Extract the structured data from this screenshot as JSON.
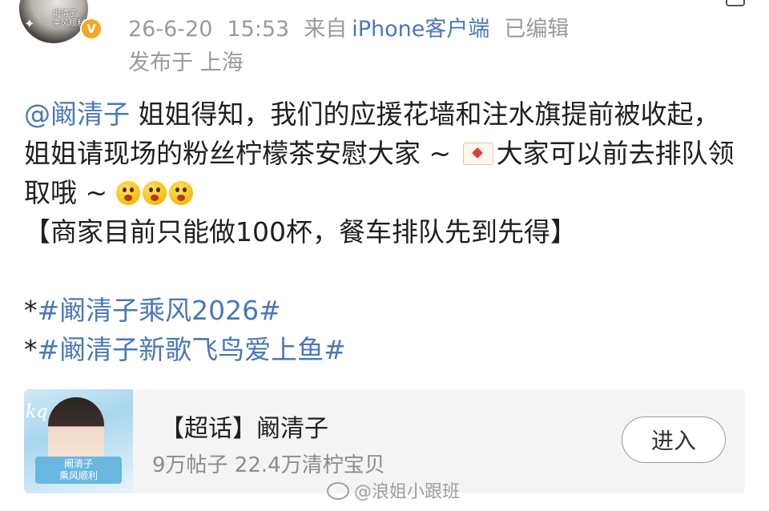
{
  "header": {
    "avatar_label": "阚清子\n乘风顺利",
    "verify_badge": "V",
    "date": "26-6-20",
    "time": "15:53",
    "source_prefix": "来自",
    "source_app": "iPhone客户端",
    "edited": "已编辑",
    "location": "发布于 上海"
  },
  "post": {
    "mention": "@阚清子",
    "line1_text": " 姐姐得知，我们的应援花墙和注水旗提前被收起，姐姐请现场的粉丝柠檬茶安慰大家 ~ ",
    "line1_after_emoji": "大家可以前去排队领取哦 ~ ",
    "notice": "【商家目前只能做100杯，餐车排队先到先得】",
    "topics": [
      {
        "prefix": "*",
        "text": "#阚清子乘风2026#"
      },
      {
        "prefix": "*",
        "text": "#阚清子新歌飞鸟爱上鱼#"
      }
    ]
  },
  "card": {
    "thumb_script": "kq",
    "thumb_tag": "阚清子\n乘风顺利",
    "title": "【超话】阚清子",
    "stats": "9万帖子 22.4万清柠宝贝",
    "button_label": "进入"
  },
  "watermark": {
    "text": "@浪姐小跟班"
  },
  "colors": {
    "link": "#4a78b8",
    "meta": "#9a9a9a",
    "card_bg": "#f4f4f4",
    "badge": "#f6a623"
  }
}
